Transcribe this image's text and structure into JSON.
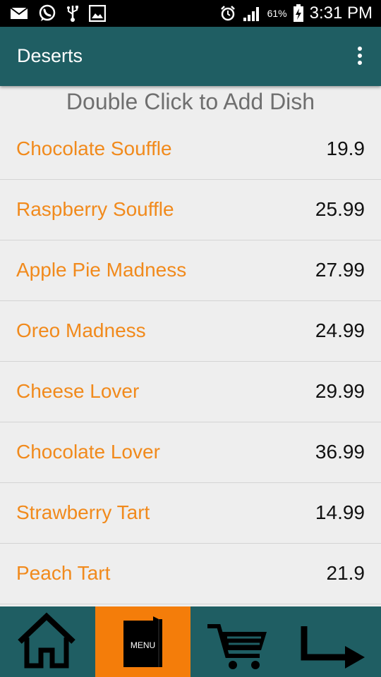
{
  "status_bar": {
    "battery": "61%",
    "time": "3:31 PM",
    "icons_left": [
      "mail-icon",
      "whatsapp-icon",
      "usb-icon",
      "gallery-icon"
    ],
    "icons_right": [
      "alarm-icon",
      "signal-icon",
      "battery-charging-icon"
    ]
  },
  "app_bar": {
    "title": "Deserts",
    "overflow_icon": "more-vert-icon"
  },
  "hint": "Double Click to Add Dish",
  "dishes": [
    {
      "name": "Chocolate Souffle",
      "price": "19.9"
    },
    {
      "name": "Raspberry Souffle",
      "price": "25.99"
    },
    {
      "name": "Apple Pie Madness",
      "price": "27.99"
    },
    {
      "name": "Oreo Madness",
      "price": "24.99"
    },
    {
      "name": "Cheese Lover",
      "price": "29.99"
    },
    {
      "name": "Chocolate Lover",
      "price": "36.99"
    },
    {
      "name": "Strawberry Tart",
      "price": "14.99"
    },
    {
      "name": "Peach Tart",
      "price": "21.9"
    }
  ],
  "bottom_nav": {
    "items": [
      {
        "icon": "home-icon"
      },
      {
        "icon": "menu-book-icon",
        "label": "MENU",
        "active": true
      },
      {
        "icon": "cart-icon"
      },
      {
        "icon": "arrow-return-icon"
      }
    ]
  },
  "colors": {
    "primary": "#1f5e63",
    "accent": "#f47d0a",
    "dish_name": "#f18a1c",
    "background": "#eeeeee"
  }
}
